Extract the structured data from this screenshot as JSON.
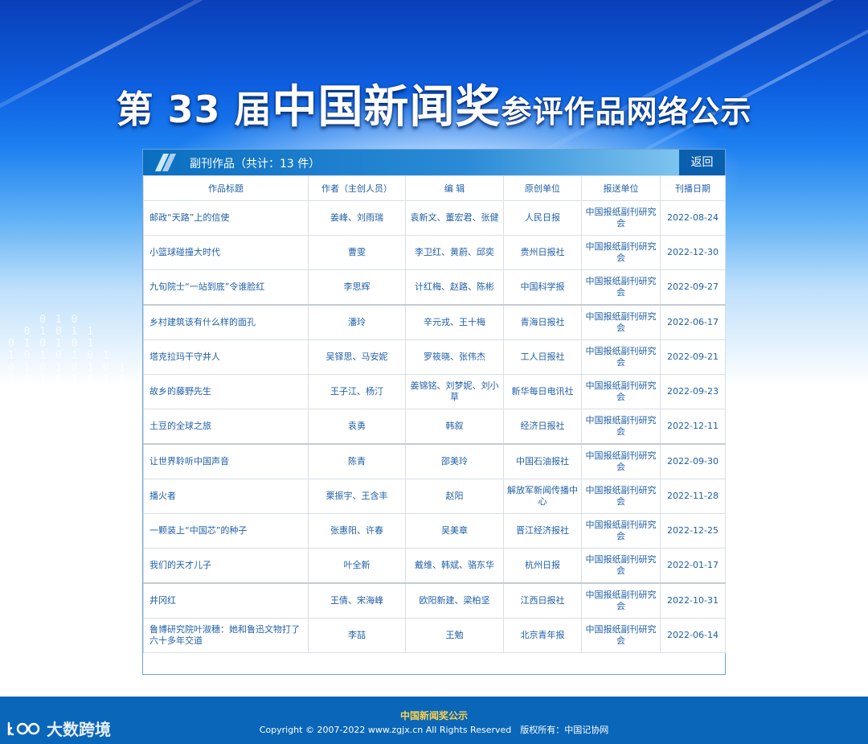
{
  "banner": {
    "prefix": "第",
    "edition": "33",
    "middle": "届",
    "award_name": "中国新闻奖",
    "suffix": "参评作品网络公示"
  },
  "panel": {
    "heading": "副刊作品（共计：13 件）",
    "back_label": "返回"
  },
  "table": {
    "columns": [
      "作品标题",
      "作者（主创人员）",
      "编 辑",
      "原创单位",
      "报送单位",
      "刊播日期"
    ],
    "rows": [
      [
        "邮政“天路”上的信使",
        "姜峰、刘雨瑞",
        "袁新文、董宏君、张健",
        "人民日报",
        "中国报纸副刊研究会",
        "2022-08-24"
      ],
      [
        "小篮球碰撞大时代",
        "曹雯",
        "李卫红、黄蔚、邱奕",
        "贵州日报社",
        "中国报纸副刊研究会",
        "2022-12-30"
      ],
      [
        "九旬院士“一站到底”令谁脸红",
        "李思辉",
        "计红梅、赵路、陈彬",
        "中国科学报",
        "中国报纸副刊研究会",
        "2022-09-27"
      ],
      [
        "乡村建筑该有什么样的面孔",
        "潘玲",
        "辛元戎、王十梅",
        "青海日报社",
        "中国报纸副刊研究会",
        "2022-06-17"
      ],
      [
        "塔克拉玛干守井人",
        "吴铎思、马安妮",
        "罗筱晓、张伟杰",
        "工人日报社",
        "中国报纸副刊研究会",
        "2022-09-21"
      ],
      [
        "故乡的藤野先生",
        "王子江、杨汀",
        "姜锦铭、刘梦妮、刘小草",
        "新华每日电讯社",
        "中国报纸副刊研究会",
        "2022-09-23"
      ],
      [
        "土豆的全球之旅",
        "袁勇",
        "韩叙",
        "经济日报社",
        "中国报纸副刊研究会",
        "2022-12-11"
      ],
      [
        "让世界聆听中国声音",
        "陈青",
        "邵美玲",
        "中国石油报社",
        "中国报纸副刊研究会",
        "2022-09-30"
      ],
      [
        "播火者",
        "栗振宇、王含丰",
        "赵阳",
        "解放军新闻传播中心",
        "中国报纸副刊研究会",
        "2022-11-28"
      ],
      [
        "一颗装上“中国芯”的种子",
        "张惠阳、许春",
        "吴美章",
        "晋江经济报社",
        "中国报纸副刊研究会",
        "2022-12-25"
      ],
      [
        "我们的天才儿子",
        "叶全新",
        "戴维、韩斌、骆东华",
        "杭州日报",
        "中国报纸副刊研究会",
        "2022-01-17"
      ],
      [
        "井冈红",
        "王倩、宋海峰",
        "欧阳新建、梁柏坚",
        "江西日报社",
        "中国报纸副刊研究会",
        "2022-10-31"
      ],
      [
        "鲁博研究院叶淑穗：她和鲁迅文物打了六十多年交道",
        "李喆",
        "王勉",
        "北京青年报",
        "中国报纸副刊研究会",
        "2022-06-14"
      ]
    ]
  },
  "footer": {
    "title": "中国新闻奖公示",
    "copyright": "Copyright © 2007-2022 www.zgjx.cn All Rights Reserved　版权所有：中国记协网"
  },
  "watermark": {
    "text": "大数跨境",
    "icon": "brand-logo-icon"
  },
  "colors": {
    "header_blue": "#0b6fc1",
    "link_text": "#1f5fa8",
    "footer_bg": "#0a66b8",
    "footer_title": "#ffd24a"
  }
}
